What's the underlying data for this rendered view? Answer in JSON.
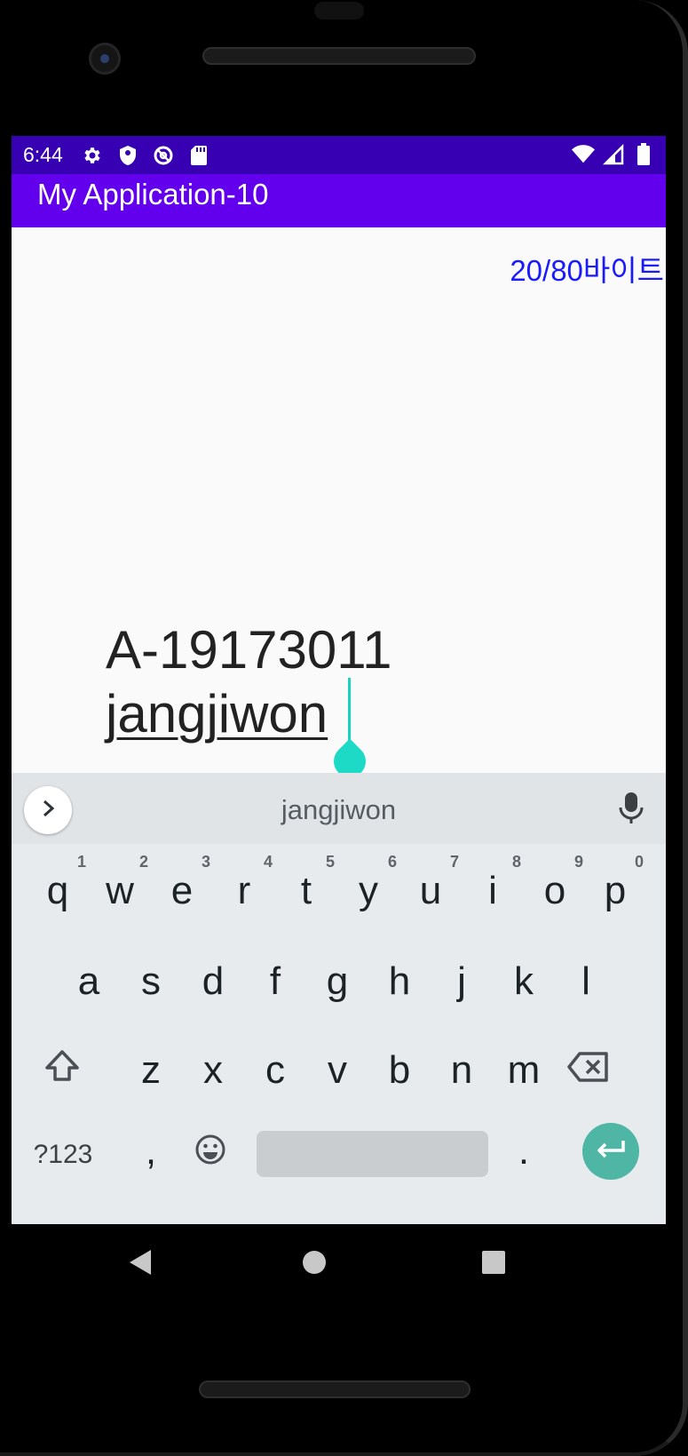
{
  "status_bar": {
    "time": "6:44",
    "left_icons": [
      "gear-icon",
      "shield-icon",
      "data-saver-icon",
      "sd-card-icon"
    ],
    "right_icons": [
      "wifi-icon",
      "signal-icon",
      "battery-icon"
    ]
  },
  "app_bar": {
    "title": "My Application-10"
  },
  "content": {
    "byte_counter": "20/80바이트",
    "text_line_1": "A-19173011",
    "text_line_2": "jangjiwon"
  },
  "keyboard": {
    "suggestion": "jangjiwon",
    "row1": [
      {
        "label": "q",
        "hint": "1"
      },
      {
        "label": "w",
        "hint": "2"
      },
      {
        "label": "e",
        "hint": "3"
      },
      {
        "label": "r",
        "hint": "4"
      },
      {
        "label": "t",
        "hint": "5"
      },
      {
        "label": "y",
        "hint": "6"
      },
      {
        "label": "u",
        "hint": "7"
      },
      {
        "label": "i",
        "hint": "8"
      },
      {
        "label": "o",
        "hint": "9"
      },
      {
        "label": "p",
        "hint": "0"
      }
    ],
    "row2": [
      "a",
      "s",
      "d",
      "f",
      "g",
      "h",
      "j",
      "k",
      "l"
    ],
    "row3": [
      "z",
      "x",
      "c",
      "v",
      "b",
      "n",
      "m"
    ],
    "row4": {
      "symbols": "?123",
      "comma": ",",
      "period": "."
    }
  },
  "colors": {
    "status_bar": "#3700b3",
    "app_bar": "#6200ee",
    "byte_counter": "#1a1aff",
    "cursor": "#1ddac6",
    "enter_key": "#4fb6a6"
  }
}
